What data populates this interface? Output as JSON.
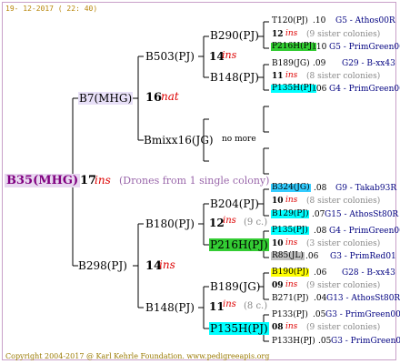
{
  "header_date": "19- 12-2017 ( 22: 40)",
  "root": {
    "label": "B35(MHG)",
    "gen_num": "17",
    "gen_word": "ins",
    "drones": "(Drones from 1 single colony)"
  },
  "sire": {
    "label": "B7(MHG)",
    "gen_num": "16",
    "gen_word": "nat"
  },
  "dam": {
    "label": "B298(PJ)",
    "gen_num": "14",
    "gen_word": "ins"
  },
  "l3": {
    "b503": {
      "label": "B503(PJ)",
      "gen_num": "14",
      "gen_word": "ins"
    },
    "bmix": {
      "label": "Bmixx16(JG)",
      "note": "no more"
    },
    "b180": {
      "label": "B180(PJ)",
      "gen_num": "12",
      "gen_word": "ins",
      "sis": "(9 c.)"
    },
    "b148b": {
      "label": "B148(PJ)",
      "gen_num": "11",
      "gen_word": "ins",
      "sis": "(8 c.)"
    }
  },
  "l4": {
    "b290": "B290(PJ)",
    "b148a": "B148(PJ)",
    "b204": "B204(PJ)",
    "p216": "P216H(PJ)",
    "b189": "B189(JG)",
    "p135": "P135H(PJ)"
  },
  "l5": {
    "g1": {
      "top": "T120(PJ)",
      "top_sfx": ".10",
      "top_gen": "G5 - Athos00R",
      "mid_num": "12",
      "mid_word": "ins",
      "mid_sis": "(9 sister colonies)",
      "bot": "P216H(PJ)",
      "bot_sfx": ".10",
      "bot_gen": "G5 - PrimGreen00"
    },
    "g2": {
      "top": "B189(JG)",
      "top_sfx": ".09",
      "top_gen": "G29 - B-xx43",
      "mid_num": "11",
      "mid_word": "ins",
      "mid_sis": "(8 sister colonies)",
      "bot": "P135H(PJ)",
      "bot_sfx": ".06",
      "bot_gen": "G4 - PrimGreen00"
    },
    "g3": {
      "top": "B324(JG)",
      "top_sfx": ".08",
      "top_gen": "G9 - Takab93R",
      "mid_num": "10",
      "mid_word": "ins",
      "mid_sis": "(8 sister colonies)",
      "bot": "B129(PJ)",
      "bot_sfx": ".07",
      "bot_gen": "G15 - AthosSt80R"
    },
    "g4": {
      "top": "P135(PJ)",
      "top_sfx": ".08",
      "top_gen": "G4 - PrimGreen00",
      "mid_num": "10",
      "mid_word": "ins",
      "mid_sis": "(3 sister colonies)",
      "bot": "R85(JL)",
      "bot_sfx": ".06",
      "bot_gen": "G3 - PrimRed01"
    },
    "g5": {
      "top": "B190(PJ)",
      "top_sfx": ".06",
      "top_gen": "G28 - B-xx43",
      "mid_num": "09",
      "mid_word": "ins",
      "mid_sis": "(9 sister colonies)",
      "bot": "B271(PJ)",
      "bot_sfx": ".04",
      "bot_gen": "G13 - AthosSt80R"
    },
    "g6": {
      "top": "P133(PJ)",
      "top_sfx": ".05",
      "top_gen": "G3 - PrimGreen00",
      "mid_num": "08",
      "mid_word": "ins",
      "mid_sis": "(9 sister colonies)",
      "bot": "P133H(PJ)",
      "bot_sfx": ".05",
      "bot_gen": "G3 - PrimGreen00"
    }
  },
  "footer": "Copyright 2004-2017 @ Karl Kehrle Foundation.   www.pedigreeapis.org",
  "colors": {
    "line": "#000000",
    "frame": "#c8a0c8",
    "ins_red": "#dd0000",
    "green_box": "#33cc33",
    "cyan_box": "#00ffff",
    "yellow_box": "#ffff00"
  }
}
